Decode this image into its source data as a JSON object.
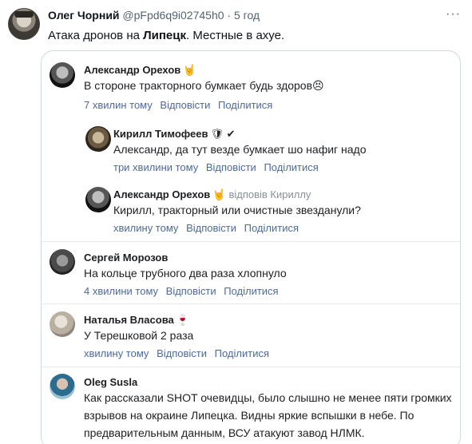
{
  "tweet": {
    "author_name": "Олег Чорний",
    "handle": "@pFpd6q9i02745h0",
    "separator": "·",
    "time": "5 год",
    "text_prefix": "Атака дронов на ",
    "text_bold": "Липецк",
    "text_suffix": ". Местные в ахуе."
  },
  "comments": [
    {
      "name": "Александр Орехов",
      "emoji": "🤘",
      "text": "В стороне тракторного бумкает будь здоров😣",
      "time": "7 хвилин тому",
      "reply_label": "Відповісти",
      "share_label": "Поділитися"
    },
    {
      "name": "Кирилл Тимофеев",
      "emoji": "🛡 ✔",
      "text": "Александр, да тут везде бумкает шо нафиг надо",
      "time": "три хвилини тому",
      "reply_label": "Відповісти",
      "share_label": "Поділитися"
    },
    {
      "name": "Александр Орехов",
      "emoji": "🤘",
      "reply_to": "відповів Кириллу",
      "text": "Кирилл, тракторный или очистные звезданули?",
      "time": "хвилину тому",
      "reply_label": "Відповісти",
      "share_label": "Поділитися"
    },
    {
      "name": "Сергей Морозов",
      "text": "На кольце трубного два раза хлопнуло",
      "time": "4 хвилини тому",
      "reply_label": "Відповісти",
      "share_label": "Поділитися"
    },
    {
      "name": "Наталья Власова",
      "emoji": "🍷",
      "text": "У Терешковой 2 раза",
      "time": "хвилину тому",
      "reply_label": "Відповісти",
      "share_label": "Поділитися"
    },
    {
      "name": "Oleg Susla",
      "text_lines": [
        "Как рассказали SHOT очевидцы, было слышно не менее пяти громких",
        "взрывов на окраине Липецка. Видны яркие вспышки в небе. По",
        "предварительным данным, ВСУ атакуют завод НЛМК."
      ]
    }
  ],
  "icons": {
    "more": "more-icon"
  },
  "colors": {
    "link_blue": "#4d6b9a",
    "border": "#cfd9de"
  }
}
